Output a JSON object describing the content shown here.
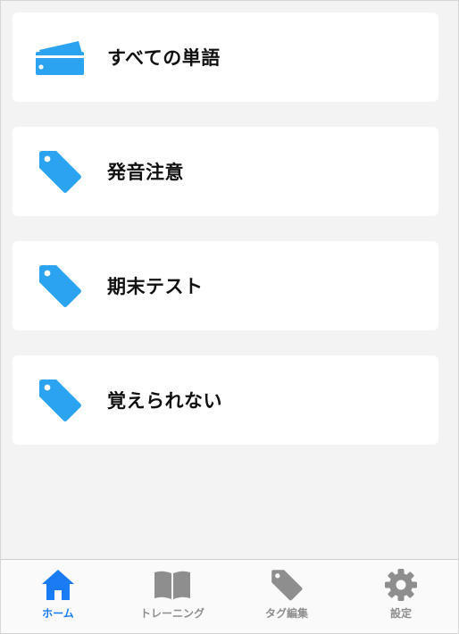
{
  "colors": {
    "accent": "#1a7cf5",
    "card_icon": "#2ba3f0",
    "inactive_tab": "#8e8e8e",
    "background": "#f3f3f3"
  },
  "cards": [
    {
      "label": "すべての単語",
      "icon": "card-stack-icon"
    },
    {
      "label": "発音注意",
      "icon": "tag-icon"
    },
    {
      "label": "期末テスト",
      "icon": "tag-icon"
    },
    {
      "label": "覚えられない",
      "icon": "tag-icon"
    }
  ],
  "tabbar": {
    "active": "home",
    "tabs": [
      {
        "id": "home",
        "label": "ホーム",
        "icon": "home-icon"
      },
      {
        "id": "training",
        "label": "トレーニング",
        "icon": "book-icon"
      },
      {
        "id": "tag-edit",
        "label": "タグ編集",
        "icon": "tag-icon"
      },
      {
        "id": "settings",
        "label": "設定",
        "icon": "gear-icon"
      }
    ]
  }
}
